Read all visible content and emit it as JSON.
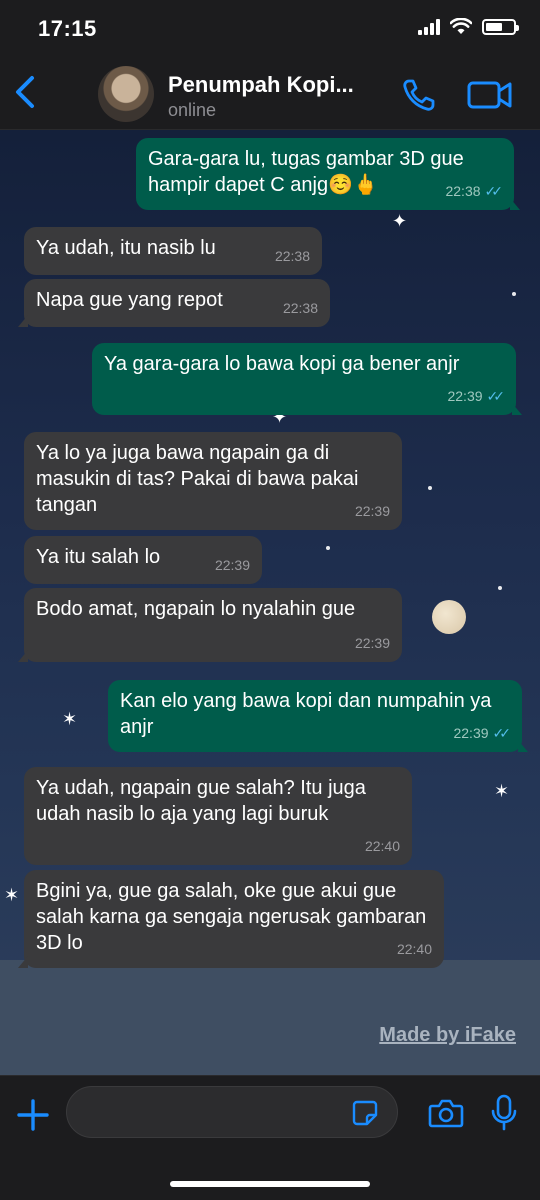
{
  "status_bar": {
    "time": "17:15"
  },
  "header": {
    "contact_name": "Penumpah Kopi...",
    "contact_status": "online",
    "accent": "#1a8cff"
  },
  "messages": [
    {
      "direction": "out",
      "text": "Gara-gara lu, tugas gambar 3D gue hampir dapet C anjg☺️🖕",
      "time": "22:38",
      "read": true
    },
    {
      "direction": "in",
      "text": "Ya udah, itu nasib lu",
      "time": "22:38"
    },
    {
      "direction": "in",
      "text": "Napa gue yang repot",
      "time": "22:38"
    },
    {
      "direction": "out",
      "text": "Ya gara-gara lo bawa kopi ga bener anjr",
      "time": "22:39",
      "read": true
    },
    {
      "direction": "in",
      "text": "Ya lo ya juga bawa ngapain ga di masukin di tas? Pakai di bawa pakai tangan",
      "time": "22:39"
    },
    {
      "direction": "in",
      "text": "Ya itu salah lo",
      "time": "22:39"
    },
    {
      "direction": "in",
      "text": "Bodo amat, ngapain lo nyalahin gue",
      "time": "22:39"
    },
    {
      "direction": "out",
      "text": "Kan elo yang bawa kopi dan numpahin ya anjr",
      "time": "22:39",
      "read": true
    },
    {
      "direction": "in",
      "text": "Ya udah, ngapain gue salah? Itu juga udah nasib lo aja yang lagi buruk",
      "time": "22:40"
    },
    {
      "direction": "in",
      "text": "Bgini ya, gue ga salah, oke gue akui gue salah karna ga sengaja ngerusak gambaran 3D lo",
      "time": "22:40"
    }
  ],
  "watermark": "Made by iFake",
  "input": {
    "placeholder": ""
  },
  "colors": {
    "incoming_bubble": "#3a3a3c",
    "outgoing_bubble": "#005c4b",
    "read_tick": "#53bdeb",
    "icon_blue": "#1a8cff"
  }
}
